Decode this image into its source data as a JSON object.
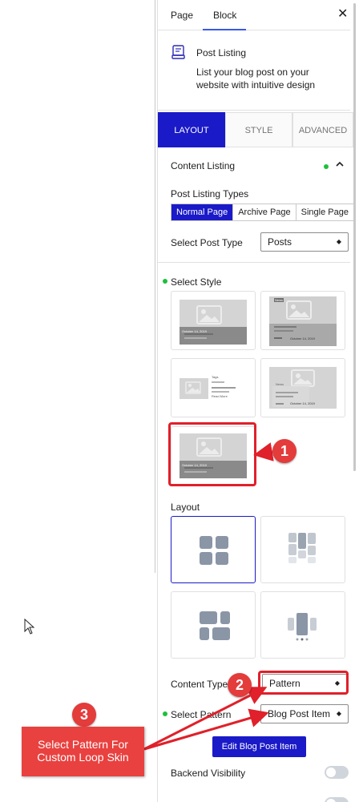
{
  "tabs": {
    "page": "Page",
    "block": "Block"
  },
  "block": {
    "title": "Post Listing",
    "description": "List your blog post on your website with intuitive design"
  },
  "settings_tabs": [
    "LAYOUT",
    "STYLE",
    "ADVANCED"
  ],
  "content_listing": {
    "heading": "Content Listing"
  },
  "post_listing_types": {
    "label": "Post Listing Types",
    "options": [
      "Normal Page",
      "Archive Page",
      "Single Page"
    ],
    "selected": "Normal Page"
  },
  "post_type": {
    "label": "Select Post Type",
    "value": "Posts"
  },
  "select_style": {
    "label": "Select Style",
    "cards": [
      {
        "date": "October 14, 2019"
      },
      {
        "date": "October 14, 2019",
        "tag": "News"
      },
      {
        "date": "",
        "meta": "Tags",
        "read_more": "Read More"
      },
      {
        "date": "October 14, 2019",
        "meta": "News"
      },
      {
        "date": "October 14, 2019"
      }
    ]
  },
  "layout": {
    "label": "Layout"
  },
  "content_type": {
    "label": "Content Type",
    "value": "Pattern"
  },
  "select_pattern": {
    "label": "Select Pattern",
    "value": "Blog Post Item"
  },
  "edit_button": "Edit Blog Post Item",
  "backend_visibility": {
    "label": "Backend Visibility"
  },
  "annotations": {
    "badges": [
      "1",
      "2",
      "3"
    ],
    "callout": "Select Pattern For Custom Loop Skin"
  },
  "colors": {
    "primary": "#1a1ac8",
    "annotation_red": "#e43b3b",
    "status_green": "#1fbf3b"
  }
}
